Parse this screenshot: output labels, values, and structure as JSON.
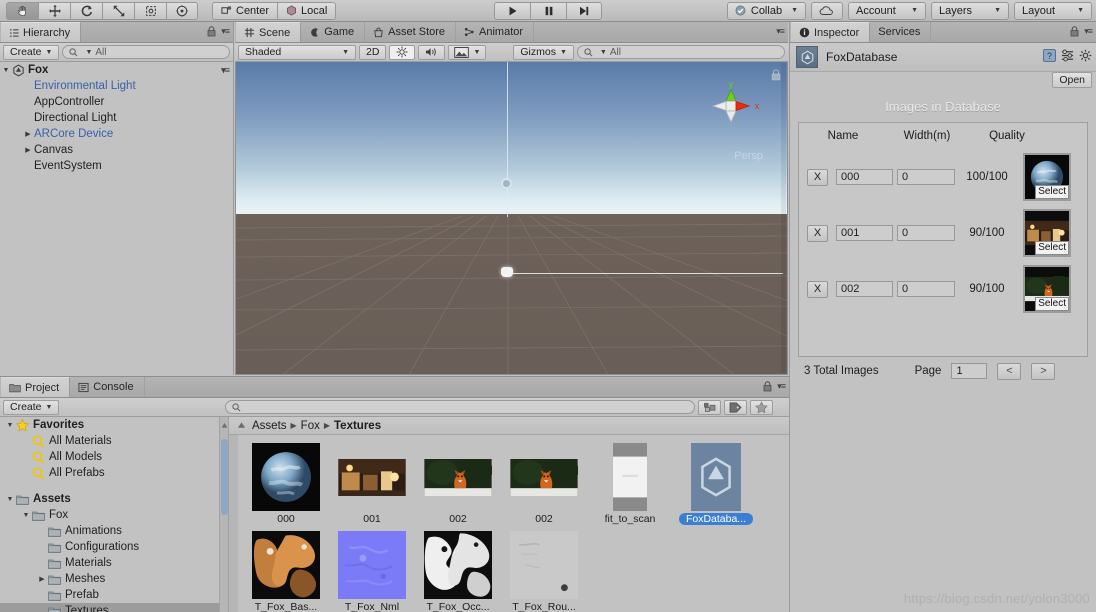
{
  "toolbar": {
    "tools": [
      {
        "name": "hand-tool",
        "glyph": "hand",
        "selected": true
      },
      {
        "name": "move-tool",
        "glyph": "move",
        "selected": false
      },
      {
        "name": "rotate-tool",
        "glyph": "rotate",
        "selected": false
      },
      {
        "name": "scale-tool",
        "glyph": "scale",
        "selected": false
      },
      {
        "name": "rect-tool",
        "glyph": "rect",
        "selected": false
      },
      {
        "name": "transform-tool",
        "glyph": "transform",
        "selected": false
      }
    ],
    "pivot_label": "Center",
    "space_label": "Local",
    "play_label": "play-icon",
    "pause_label": "pause-icon",
    "step_label": "step-icon",
    "collab_label": "Collab",
    "cloud_label": "cloud-icon",
    "account_label": "Account",
    "layers_label": "Layers",
    "layout_label": "Layout"
  },
  "hierarchy": {
    "tab_label": "Hierarchy",
    "create_label": "Create",
    "search_placeholder": "All",
    "root": "Fox",
    "items": [
      {
        "label": "Environmental Light",
        "indent": 1,
        "expandable": false,
        "prefab": true
      },
      {
        "label": "AppController",
        "indent": 1,
        "expandable": false,
        "prefab": false
      },
      {
        "label": "Directional Light",
        "indent": 1,
        "expandable": false,
        "prefab": false
      },
      {
        "label": "ARCore Device",
        "indent": 1,
        "expandable": true,
        "prefab": true
      },
      {
        "label": "Canvas",
        "indent": 1,
        "expandable": true,
        "prefab": false
      },
      {
        "label": "EventSystem",
        "indent": 1,
        "expandable": false,
        "prefab": false
      }
    ]
  },
  "scene": {
    "tabs": [
      {
        "label": "Scene",
        "icon": "grid-icon",
        "active": true
      },
      {
        "label": "Game",
        "icon": "gamepad-icon",
        "active": false
      },
      {
        "label": "Asset Store",
        "icon": "store-icon",
        "active": false
      },
      {
        "label": "Animator",
        "icon": "animator-icon",
        "active": false
      }
    ],
    "draw_mode": "Shaded",
    "toggle_2d": "2D",
    "light_icon": "sun-icon",
    "audio_icon": "speaker-icon",
    "fx_icon": "image-icon",
    "gizmos_label": "Gizmos",
    "search_placeholder": "All",
    "gizmo_axes": {
      "y": "y",
      "x": "x"
    },
    "projection_label": "Persp"
  },
  "inspector": {
    "tabs": [
      {
        "label": "Inspector",
        "icon": "info-icon",
        "active": true
      },
      {
        "label": "Services",
        "icon": "",
        "active": false
      }
    ],
    "asset_name": "FoxDatabase",
    "asset_icon": "unity-asset-icon",
    "header_icons": [
      "help-icon",
      "preset-icon",
      "gear-icon"
    ],
    "open_label": "Open",
    "database_title": "Images in Database",
    "columns": [
      "Name",
      "Width(m)",
      "Quality"
    ],
    "rows": [
      {
        "remove_label": "X",
        "name": "000",
        "width": "0",
        "quality": "100/100",
        "select_label": "Select",
        "thumb": "earth"
      },
      {
        "remove_label": "X",
        "name": "001",
        "width": "0",
        "quality": "90/100",
        "select_label": "Select",
        "thumb": "interior"
      },
      {
        "remove_label": "X",
        "name": "002",
        "width": "0",
        "quality": "90/100",
        "select_label": "Select",
        "thumb": "fox"
      }
    ],
    "total_images": "3 Total Images",
    "page_label": "Page",
    "page_value": "1",
    "prev_label": "<",
    "next_label": ">"
  },
  "project": {
    "tabs": [
      {
        "label": "Project",
        "icon": "folder-icon",
        "active": true
      },
      {
        "label": "Console",
        "icon": "console-icon",
        "active": false
      }
    ],
    "create_label": "Create",
    "search_placeholder": "",
    "filter_icons": [
      "type-filter-icon",
      "label-filter-icon",
      "favorite-filter-icon"
    ],
    "tree": [
      {
        "label": "Favorites",
        "indent": 0,
        "icon": "star",
        "expandable": true,
        "bold": true,
        "selected": false
      },
      {
        "label": "All Materials",
        "indent": 1,
        "icon": "search",
        "expandable": false,
        "bold": false,
        "selected": false
      },
      {
        "label": "All Models",
        "indent": 1,
        "icon": "search",
        "expandable": false,
        "bold": false,
        "selected": false
      },
      {
        "label": "All Prefabs",
        "indent": 1,
        "icon": "search",
        "expandable": false,
        "bold": false,
        "selected": false
      },
      {
        "label": "",
        "indent": 0,
        "icon": "none",
        "expandable": false,
        "bold": false,
        "selected": false
      },
      {
        "label": "Assets",
        "indent": 0,
        "icon": "folder",
        "expandable": true,
        "bold": true,
        "selected": false
      },
      {
        "label": "Fox",
        "indent": 1,
        "icon": "folder",
        "expandable": true,
        "bold": false,
        "selected": false
      },
      {
        "label": "Animations",
        "indent": 2,
        "icon": "folder",
        "expandable": false,
        "bold": false,
        "selected": false
      },
      {
        "label": "Configurations",
        "indent": 2,
        "icon": "folder",
        "expandable": false,
        "bold": false,
        "selected": false
      },
      {
        "label": "Materials",
        "indent": 2,
        "icon": "folder",
        "expandable": false,
        "bold": false,
        "selected": false
      },
      {
        "label": "Meshes",
        "indent": 2,
        "icon": "folder",
        "expandable": true,
        "bold": false,
        "selected": false
      },
      {
        "label": "Prefab",
        "indent": 2,
        "icon": "folder",
        "expandable": false,
        "bold": false,
        "selected": false
      },
      {
        "label": "Textures",
        "indent": 2,
        "icon": "folder",
        "expandable": false,
        "bold": false,
        "selected": true
      }
    ],
    "breadcrumb": [
      "Assets",
      "Fox",
      "Textures"
    ],
    "assets": [
      {
        "label": "000",
        "thumb": "earth",
        "selected": false
      },
      {
        "label": "001",
        "thumb": "interior",
        "selected": false
      },
      {
        "label": "002",
        "thumb": "fox-a",
        "selected": false
      },
      {
        "label": "002",
        "thumb": "fox-b",
        "selected": false
      },
      {
        "label": "fit_to_scan",
        "thumb": "fit-scan",
        "selected": false
      },
      {
        "label": "FoxDataba...",
        "thumb": "unity-asset",
        "selected": true
      },
      {
        "label": "T_Fox_Bas...",
        "thumb": "fox-basecolor",
        "selected": false
      },
      {
        "label": "T_Fox_Nml",
        "thumb": "fox-normal",
        "selected": false
      },
      {
        "label": "T_Fox_Occ...",
        "thumb": "fox-occlusion",
        "selected": false
      },
      {
        "label": "T_Fox_Rou...",
        "thumb": "fox-roughness",
        "selected": false
      }
    ]
  },
  "watermark": "https://blog.csdn.net/yolon3000"
}
